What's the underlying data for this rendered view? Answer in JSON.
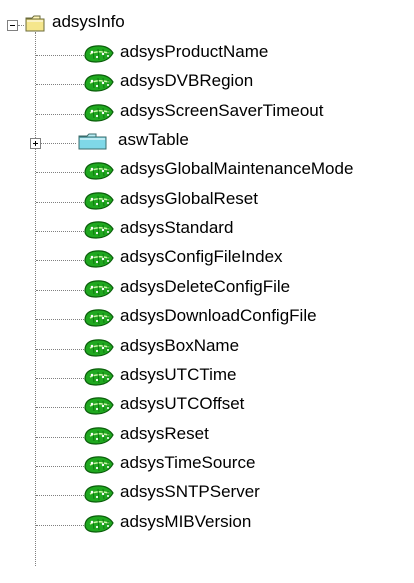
{
  "tree": {
    "root": {
      "label": "adsysInfo",
      "icon": "folder-open-icon",
      "folder_color": "#f5e68c"
    },
    "children": [
      {
        "label": "adsysProductName",
        "type": "leaf"
      },
      {
        "label": "adsysDVBRegion",
        "type": "leaf"
      },
      {
        "label": "adsysScreenSaverTimeout",
        "type": "leaf"
      },
      {
        "label": "aswTable",
        "type": "folder",
        "collapsed": true
      },
      {
        "label": "adsysGlobalMaintenanceMode",
        "type": "leaf"
      },
      {
        "label": "adsysGlobalReset",
        "type": "leaf"
      },
      {
        "label": "adsysStandard",
        "type": "leaf"
      },
      {
        "label": "adsysConfigFileIndex",
        "type": "leaf"
      },
      {
        "label": "adsysDeleteConfigFile",
        "type": "leaf"
      },
      {
        "label": "adsysDownloadConfigFile",
        "type": "leaf"
      },
      {
        "label": "adsysBoxName",
        "type": "leaf"
      },
      {
        "label": "adsysUTCTime",
        "type": "leaf"
      },
      {
        "label": "adsysUTCOffset",
        "type": "leaf"
      },
      {
        "label": "adsysReset",
        "type": "leaf"
      },
      {
        "label": "adsysTimeSource",
        "type": "leaf"
      },
      {
        "label": "adsysSNTPServer",
        "type": "leaf"
      },
      {
        "label": "adsysMIBVersion",
        "type": "leaf"
      }
    ],
    "colors": {
      "leaf_green": "#1fa81f",
      "leaf_dark": "#0b5e0b",
      "table_folder": "#7fd8e8"
    }
  }
}
